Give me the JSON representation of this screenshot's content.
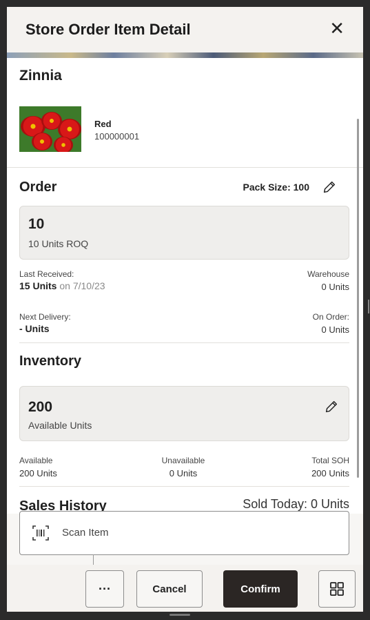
{
  "header": {
    "title": "Store Order Item Detail",
    "close_icon": "close-icon"
  },
  "product": {
    "name": "Zinnia",
    "variant": "Red",
    "sku": "100000001"
  },
  "order": {
    "title": "Order",
    "pack_size": "Pack Size: 100",
    "quantity": "10",
    "quantity_sub": "10 Units ROQ",
    "last_received_label": "Last Received:",
    "last_received_value": "15  Units",
    "last_received_date": "on 7/10/23",
    "warehouse_label": "Warehouse",
    "warehouse_value": "0 Units",
    "next_delivery_label": "Next Delivery:",
    "next_delivery_value": "-  Units",
    "on_order_label": "On Order:",
    "on_order_value": "0 Units"
  },
  "inventory": {
    "title": "Inventory",
    "quantity": "200",
    "quantity_sub": "Available Units",
    "available_label": "Available",
    "available_value": "200 Units",
    "unavailable_label": "Unavailable",
    "unavailable_value": "0 Units",
    "total_soh_label": "Total SOH",
    "total_soh_value": "200 Units"
  },
  "sales_history": {
    "title": "Sales History",
    "sold_today": "Sold Today: 0 Units"
  },
  "scan": {
    "label": "Scan Item"
  },
  "footer": {
    "more_label": "···",
    "cancel_label": "Cancel",
    "confirm_label": "Confirm"
  },
  "colors": {
    "primary_button": "#2b2624",
    "background": "#f7f6f4",
    "card": "#efeeec"
  }
}
